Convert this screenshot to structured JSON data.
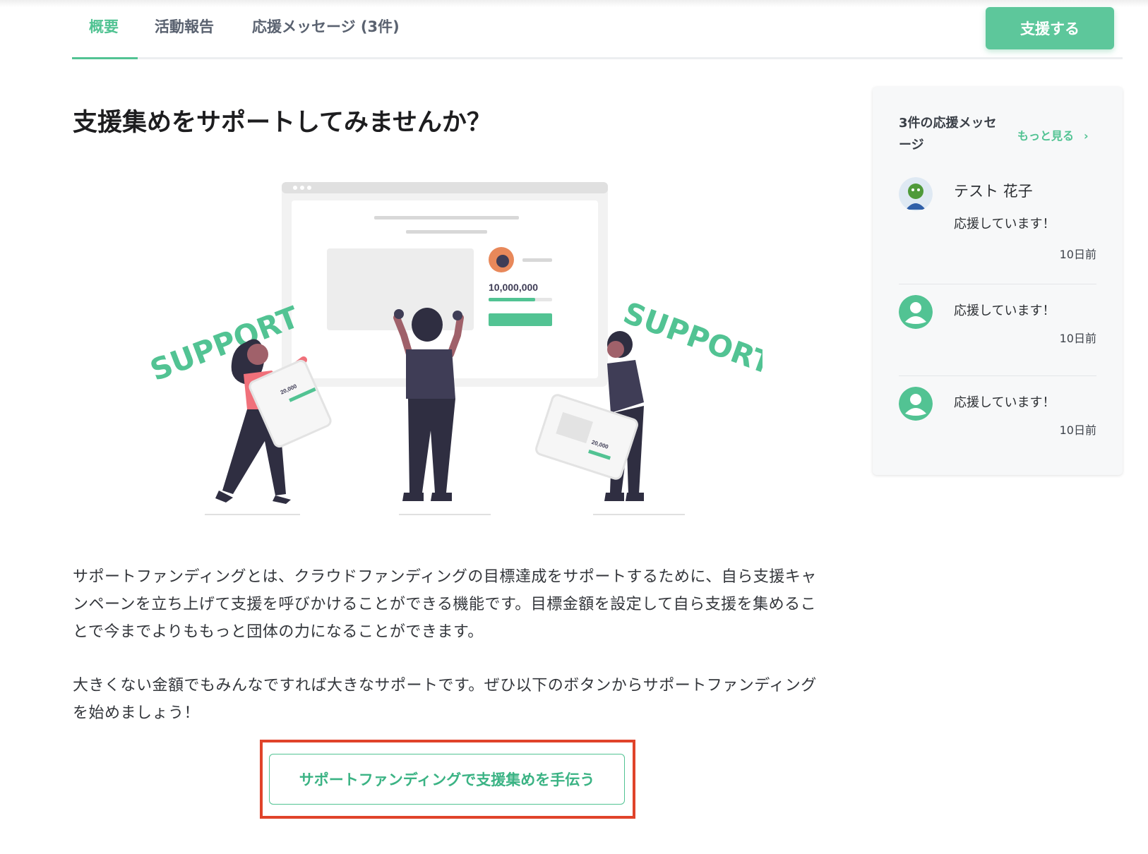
{
  "tabs": [
    {
      "label": "概要",
      "active": true
    },
    {
      "label": "活動報告",
      "active": false
    },
    {
      "label": "応援メッセージ (3件)",
      "active": false
    }
  ],
  "support_button": "支援する",
  "main": {
    "title": "支援集めをサポートしてみませんか？",
    "illustration": {
      "amount": "10,000,000",
      "support_word": "SUPPORT",
      "tablet_amount": "20,000"
    },
    "paragraphs": [
      "サポートファンディングとは、クラウドファンディングの目標達成をサポートするために、自ら支援キャンペーンを立ち上げて支援を呼びかけることができる機能です。目標金額を設定して自ら支援を集めることで今までよりももっと団体の力になることができます。",
      "大きくない金額でもみんなですれば大きなサポートです。ぜひ以下のボタンからサポートファンディングを始めましょう！"
    ],
    "cta_button": "サポートファンディングで支援集めを手伝う"
  },
  "sidebar": {
    "title": "3件の応援メッセージ",
    "more_link": "もっと見る",
    "more_icon": "chevron-right-icon",
    "messages": [
      {
        "name": "テスト 花子",
        "text": "応援しています！",
        "time": "10日前",
        "avatar": "custom-avatar"
      },
      {
        "name": "",
        "text": "応援しています！",
        "time": "10日前",
        "avatar": "default-user-icon"
      },
      {
        "name": "",
        "text": "応援しています！",
        "time": "10日前",
        "avatar": "default-user-icon"
      }
    ]
  },
  "colors": {
    "accent": "#52c393",
    "button_bg": "#5dc79b",
    "highlight": "#e0432a",
    "figure_dark": "#3f3d56",
    "figure_shirt": "#f0707a"
  }
}
